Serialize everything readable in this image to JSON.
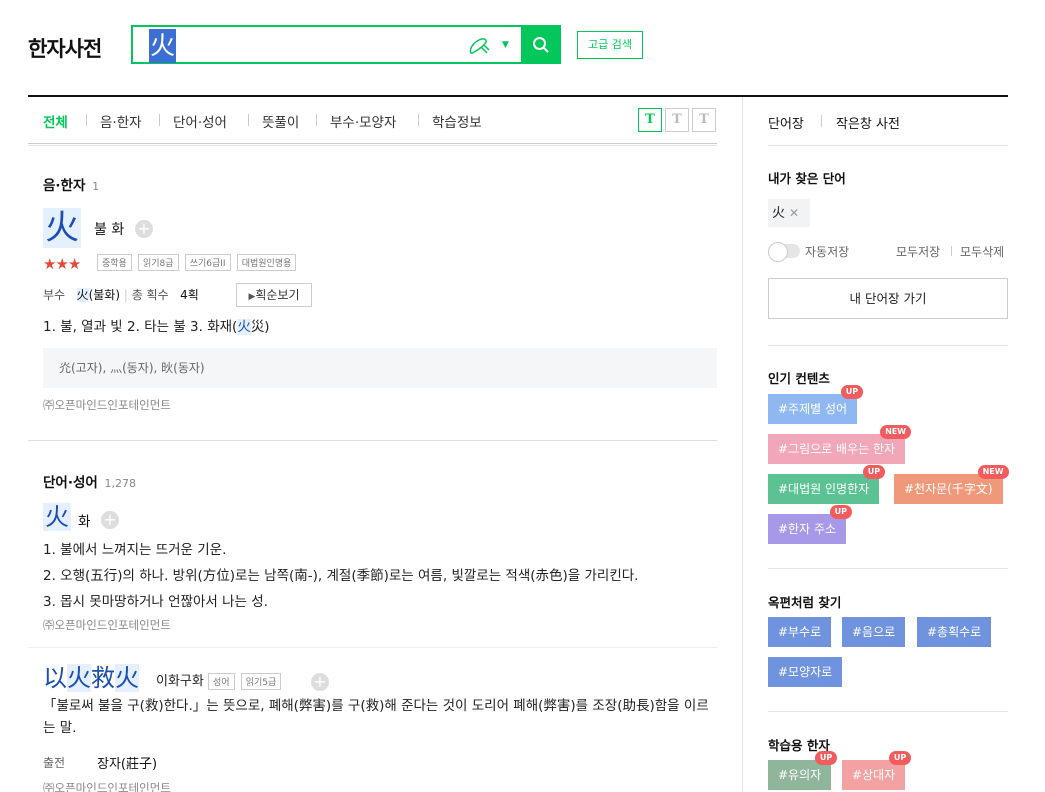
{
  "app": {
    "title": "한자사전"
  },
  "search": {
    "value": "火",
    "advanced_label": "고급 검색"
  },
  "tabs": [
    {
      "label": "전체",
      "active": true
    },
    {
      "label": "음·한자"
    },
    {
      "label": "단어·성어"
    },
    {
      "label": "뜻풀이"
    },
    {
      "label": "부수·모양자"
    },
    {
      "label": "학습정보"
    }
  ],
  "font_buttons": [
    "T",
    "T",
    "T"
  ],
  "hanja_section": {
    "title": "음·한자",
    "count": "1",
    "char": "火",
    "reading": "불 화",
    "stars": "★★★",
    "tags": [
      "중학용",
      "읽기8급",
      "쓰기6급II",
      "대법원인명용"
    ],
    "radical_label": "부수",
    "radical_char": "火",
    "radical_name": "(불화)",
    "strokes_label": "총 획수",
    "strokes_value": "4획",
    "stroke_button": "획순보기",
    "meanings_pre": "1. 불, 열과 빛  2. 타는 불  3. 화재(",
    "meanings_hl": "火",
    "meanings_post": "災)",
    "related": "灮(고자), 灬(동자), 炚(동자)",
    "credit": "㈜오픈마인드인포테인먼트"
  },
  "word_section": {
    "title": "단어·성어",
    "count": "1,278",
    "word": "火",
    "word_reading": "화",
    "definitions": [
      "1. 불에서 느껴지는 뜨거운 기운.",
      "2. 오행(五行)의 하나. 방위(方位)로는 남쪽(南-), 계절(季節)로는 여름, 빛깔로는 적색(赤色)을 가리킨다.",
      "3. 몹시 못마땅하거나 언짢아서 나는 성."
    ],
    "credit": "㈜오픈마인드인포테인먼트",
    "idiom_chars": [
      "以",
      "火",
      "救",
      "火"
    ],
    "idiom_reading": "이화구화",
    "idiom_tags": [
      "성어",
      "읽기5급"
    ],
    "idiom_definition": "「불로써 불을 구(救)한다.」는 뜻으로, 폐해(弊害)를 구(救)해 준다는 것이 도리어 폐해(弊害)를 조장(助長)함을 이르는 말.",
    "source_label": "출전",
    "source_value": "장자(莊子)",
    "credit2": "㈜오픈마인드인포테인먼트"
  },
  "sidebar": {
    "tabs": [
      "단어장",
      "작은창 사전"
    ],
    "recent_title": "내가 찾은 단어",
    "recent_word": "火",
    "auto_save": "자동저장",
    "save_all": "모두저장",
    "delete_all": "모두삭제",
    "wordbook_button": "내 단어장 가기",
    "popular_title": "인기 컨텐츠",
    "popular": [
      {
        "label": "#주제별 성어",
        "badge": "UP",
        "color": "#8fb8f2"
      },
      {
        "label": "#그림으로 배우는 한자",
        "badge": "NEW",
        "color": "#f2a7b8"
      },
      {
        "label": "#대법원 인명한자",
        "badge": "UP",
        "color": "#5cc293"
      },
      {
        "label": "#천자문(千字文)",
        "badge": "NEW",
        "color": "#f0997a"
      },
      {
        "label": "#한자 주소",
        "badge": "UP",
        "color": "#a899e8"
      }
    ],
    "jade_title": "옥편처럼 찾기",
    "jade": [
      {
        "label": "#부수로",
        "color": "#6f93dc"
      },
      {
        "label": "#음으로",
        "color": "#6f93dc"
      },
      {
        "label": "#총획수로",
        "color": "#6f93dc"
      },
      {
        "label": "#모양자로",
        "color": "#6f93dc"
      }
    ],
    "study_title": "학습용 한자",
    "study": [
      {
        "label": "#유의자",
        "badge": "UP",
        "color": "#8fb59a"
      },
      {
        "label": "#상대자",
        "badge": "UP",
        "color": "#f2a2a2"
      }
    ]
  }
}
